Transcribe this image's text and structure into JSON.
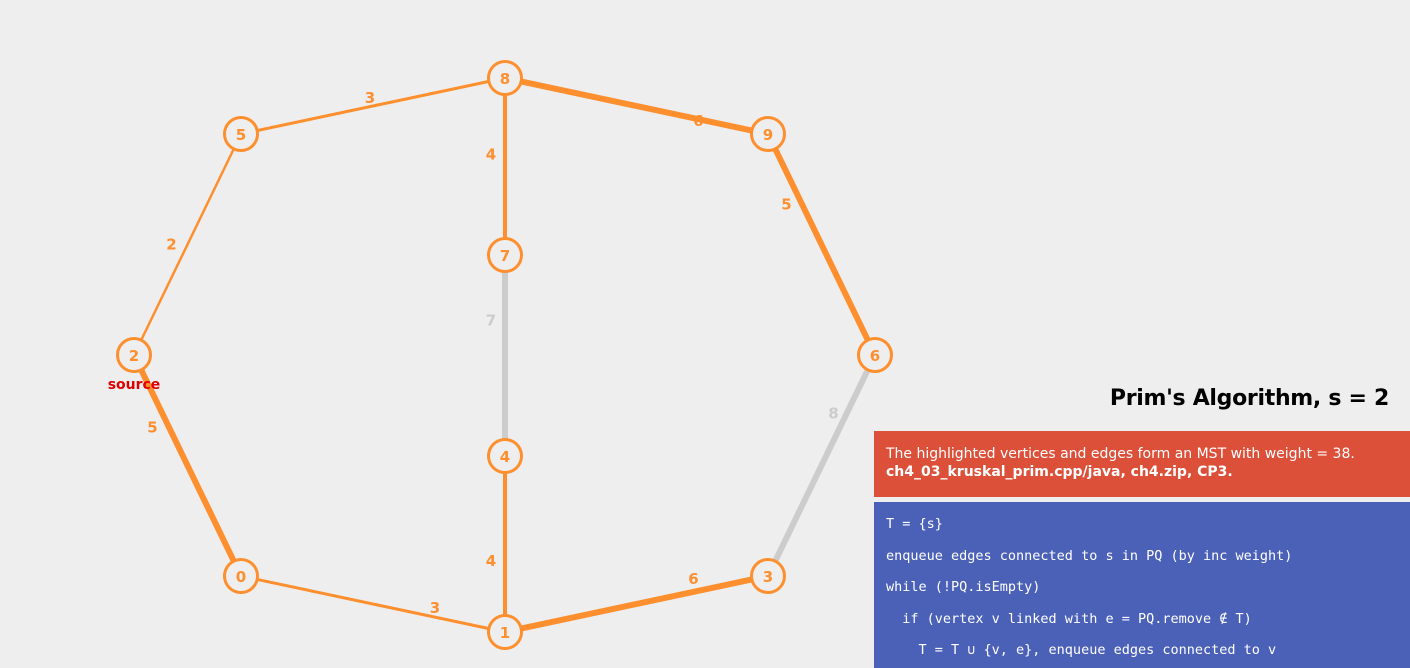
{
  "title": "Prim's Algorithm, s = 2",
  "status": {
    "message": "The highlighted vertices and edges form an MST with weight = 38.",
    "source": "ch4_03_kruskal_prim.cpp/java, ch4.zip, CP3."
  },
  "pseudocode": [
    "T = {s}",
    "enqueue edges connected to s in PQ (by inc weight)",
    "while (!PQ.isEmpty)",
    "  if (vertex v linked with e = PQ.remove ∉ T)",
    "    T = T ∪ {v, e}, enqueue edges connected to v"
  ],
  "graph": {
    "source_vertex": "2",
    "source_label": "source",
    "vertices": [
      "0",
      "1",
      "2",
      "3",
      "4",
      "5",
      "6",
      "7",
      "8",
      "9"
    ],
    "edges": [
      {
        "u": "2",
        "v": "5",
        "w": "2",
        "state": "tree"
      },
      {
        "u": "5",
        "v": "8",
        "w": "3",
        "state": "tree"
      },
      {
        "u": "8",
        "v": "7",
        "w": "4",
        "state": "tree"
      },
      {
        "u": "8",
        "v": "9",
        "w": "6",
        "state": "tree"
      },
      {
        "u": "9",
        "v": "6",
        "w": "5",
        "state": "tree"
      },
      {
        "u": "7",
        "v": "4",
        "w": "7",
        "state": "unused"
      },
      {
        "u": "6",
        "v": "3",
        "w": "8",
        "state": "unused"
      },
      {
        "u": "2",
        "v": "0",
        "w": "5",
        "state": "tree"
      },
      {
        "u": "0",
        "v": "1",
        "w": "3",
        "state": "tree"
      },
      {
        "u": "4",
        "v": "1",
        "w": "4",
        "state": "tree"
      },
      {
        "u": "1",
        "v": "3",
        "w": "6",
        "state": "tree"
      }
    ]
  },
  "colors": {
    "accent": "#fd8f2f",
    "unused_edge": "#cccccc",
    "status_bg": "#dc503a",
    "code_bg": "#4b61b8",
    "source_text": "#e00000",
    "background": "#eeeeee"
  }
}
